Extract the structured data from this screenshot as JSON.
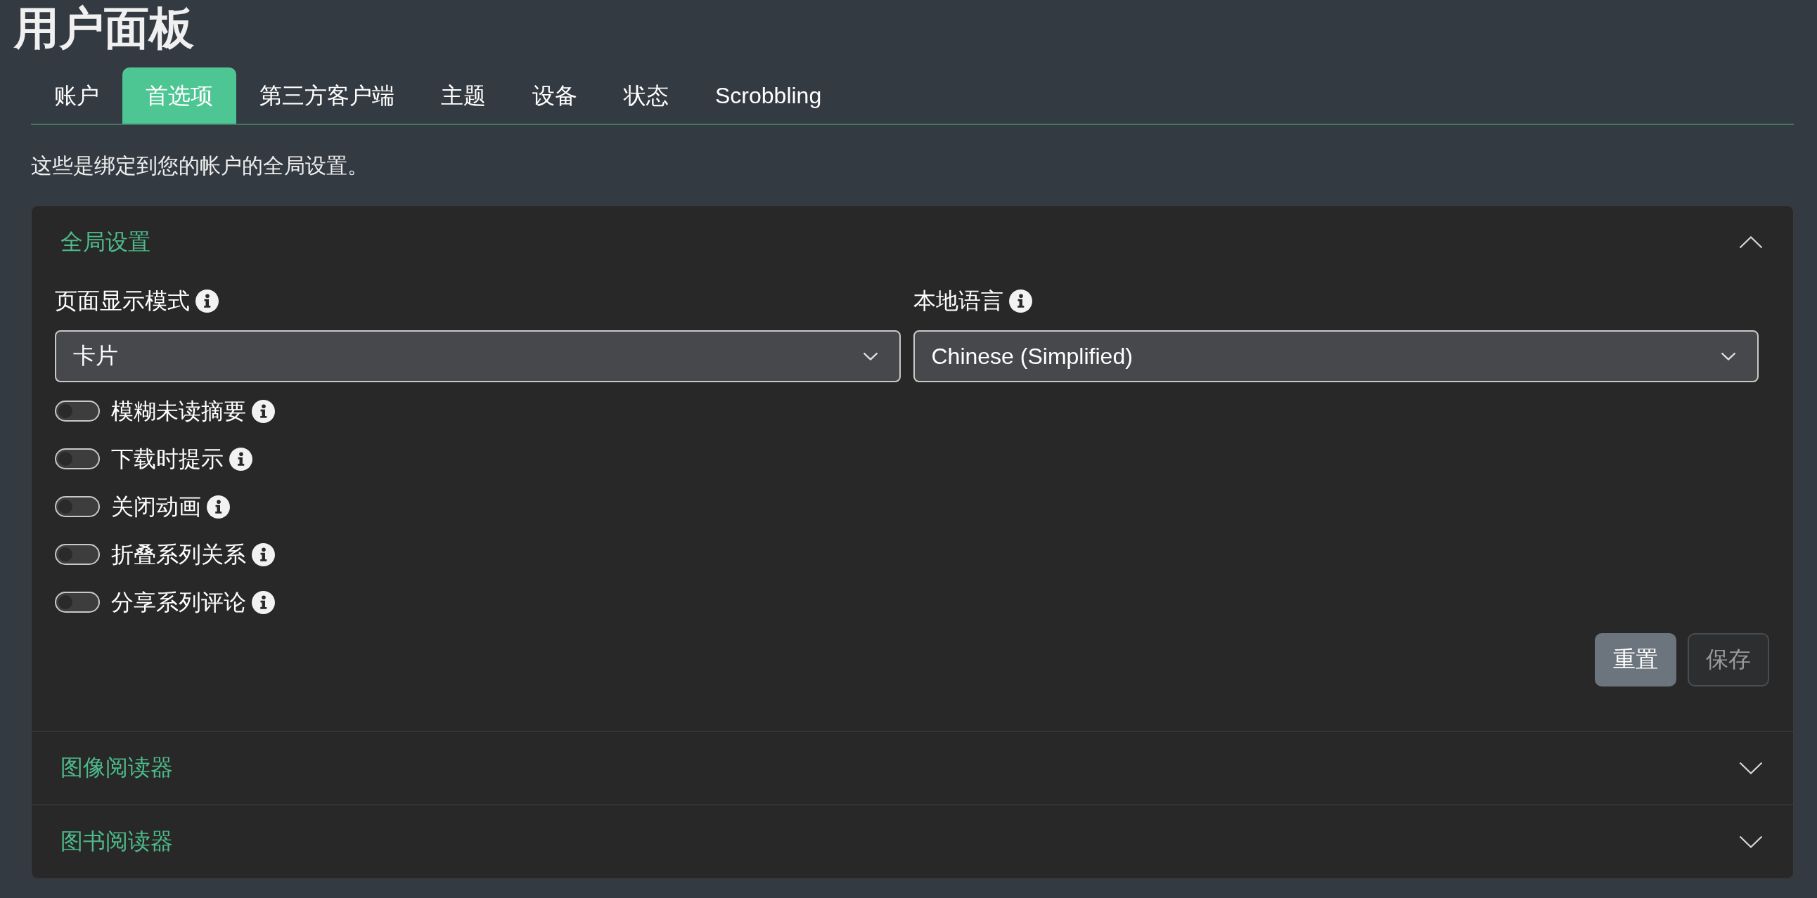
{
  "page": {
    "title": "用户面板"
  },
  "tabs": [
    {
      "label": "账户",
      "selected": false
    },
    {
      "label": "首选项",
      "selected": true
    },
    {
      "label": "第三方客户端",
      "selected": false
    },
    {
      "label": "主题",
      "selected": false
    },
    {
      "label": "设备",
      "selected": false
    },
    {
      "label": "状态",
      "selected": false
    },
    {
      "label": "Scrobbling",
      "selected": false
    }
  ],
  "description": "这些是绑定到您的帐户的全局设置。",
  "sections": [
    {
      "title": "全局设置",
      "expanded": true,
      "selects": [
        {
          "label": "页面显示模式",
          "value": "卡片"
        },
        {
          "label": "本地语言",
          "value": "Chinese (Simplified)"
        }
      ],
      "toggles": [
        {
          "label": "模糊未读摘要",
          "on": false
        },
        {
          "label": "下载时提示",
          "on": false
        },
        {
          "label": "关闭动画",
          "on": false
        },
        {
          "label": "折叠系列关系",
          "on": false
        },
        {
          "label": "分享系列评论",
          "on": false
        }
      ],
      "buttons": [
        {
          "label": "重置",
          "disabled": false
        },
        {
          "label": "保存",
          "disabled": true
        }
      ]
    },
    {
      "title": "图像阅读器",
      "expanded": false
    },
    {
      "title": "图书阅读器",
      "expanded": false
    }
  ]
}
